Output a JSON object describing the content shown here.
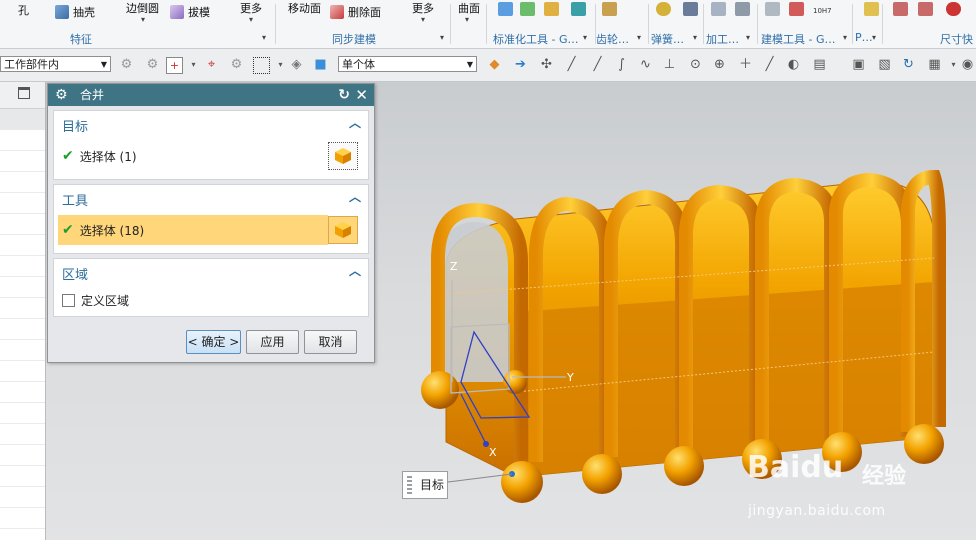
{
  "ribbon": {
    "items": [
      {
        "label": "孔",
        "icon": "hole-icon"
      },
      {
        "label": "抽壳",
        "icon": "shell-icon"
      },
      {
        "label": "边倒圆",
        "icon": "edge-blend-icon"
      },
      {
        "label": "拔模",
        "icon": "draft-icon"
      },
      {
        "label": "更多",
        "icon": "more-icon"
      },
      {
        "label": "移动面",
        "icon": "move-face-icon"
      },
      {
        "label": "删除面",
        "icon": "delete-face-icon"
      },
      {
        "label": "更多",
        "icon": "more-icon"
      },
      {
        "label": "曲面",
        "icon": "surface-icon"
      }
    ],
    "groups": {
      "feature": "特征",
      "sync_modeling": "同步建模",
      "standard_tools": "标准化工具 - G…",
      "gear": "齿轮…",
      "spring": "弹簧…",
      "machining": "加工…",
      "modeling_tools": "建模工具 - G…",
      "p": "P…",
      "dimension": "尺寸快"
    },
    "mini_icon_text": "10H7"
  },
  "toolbar": {
    "filter_scope": "工作部件内",
    "selection_type": "单个体"
  },
  "dialog": {
    "title": "合并",
    "target": {
      "header": "目标",
      "selection": "选择体 (1)"
    },
    "tool": {
      "header": "工具",
      "selection": "选择体 (18)"
    },
    "region": {
      "header": "区域",
      "checkbox_label": "定义区域",
      "checked": false
    },
    "buttons": {
      "ok": "< 确定 >",
      "apply": "应用",
      "cancel": "取消"
    }
  },
  "viewport": {
    "callout_label": "目标",
    "axis_labels": {
      "z": "Z",
      "y": "Y",
      "x": "X"
    },
    "model_color": "#f0a000",
    "watermark": {
      "logo": "Baidu",
      "cn": "经验",
      "url": "jingyan.baidu.com"
    }
  },
  "colors": {
    "dialog_title_bg": "#3e7484",
    "tool_row_highlight": "#ffd67a",
    "section_header": "#2c6e9b",
    "check": "#1f9e2c"
  }
}
